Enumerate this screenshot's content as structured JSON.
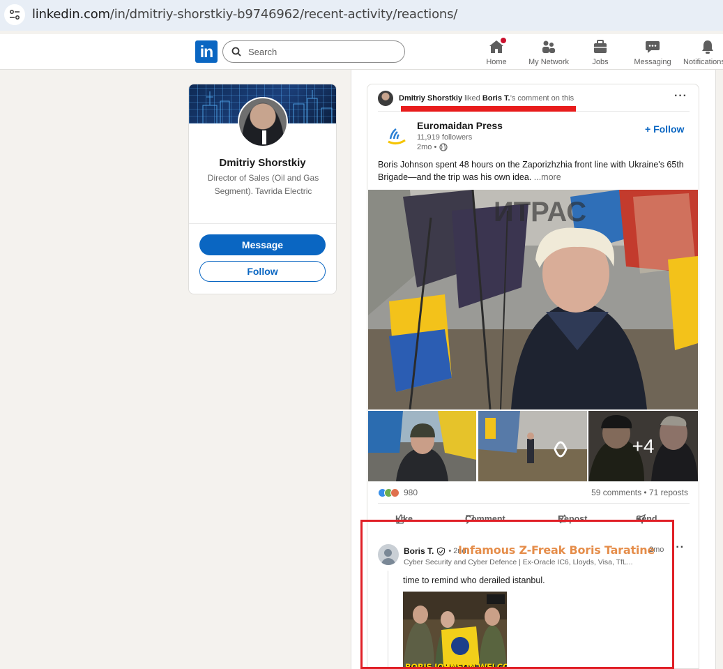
{
  "browser": {
    "url_domain": "linkedin.com",
    "url_path": "/in/dmitriy-shorstkiy-b9746962/recent-activity/reactions/"
  },
  "nav": {
    "search_placeholder": "Search",
    "items": [
      {
        "label": "Home",
        "icon": "home-icon"
      },
      {
        "label": "My Network",
        "icon": "network-icon"
      },
      {
        "label": "Jobs",
        "icon": "briefcase-icon"
      },
      {
        "label": "Messaging",
        "icon": "messaging-icon"
      },
      {
        "label": "Notifications",
        "icon": "bell-icon"
      }
    ]
  },
  "profile": {
    "name": "Dmitriy Shorstkiy",
    "title": "Director of Sales (Oil and Gas Segment). Tavrida Electric",
    "message_label": "Message",
    "follow_label": "Follow"
  },
  "activity": {
    "actor": "Dmitriy Shorstkiy",
    "verb": "liked",
    "target": "Boris T.",
    "suffix": "’s comment on this"
  },
  "post": {
    "org_name": "Euromaidan Press",
    "followers": "11,919 followers",
    "time": "2mo •",
    "follow_label": "Follow",
    "text": "Boris Johnson spent 48 hours on the Zaporizhzhia front line with Ukraine's 65th Brigade—and the trip was his own idea.",
    "more_label": "...more",
    "extra_images": "+4",
    "reaction_count": "980",
    "comments_reposts": "59 comments • 71 reposts",
    "actions": [
      "Like",
      "Comment",
      "Repost",
      "Send"
    ]
  },
  "comment": {
    "author": "Boris T.",
    "degree": "• 2nd",
    "overlay_title": "Infamous Z-Freak Boris Taratine",
    "headline": "Cyber Security and Cyber Defence | Ex-Oracle IC6, Lloyds, Visa, TfL...",
    "time": "2mo",
    "text": "time to remind who derailed istanbul.",
    "image_caption": "BORIS JOHNSON WELCOMES"
  },
  "colors": {
    "linkedin_blue": "#0a66c2",
    "annotation_red": "#e01f26",
    "overlay_orange": "#e3843b"
  }
}
